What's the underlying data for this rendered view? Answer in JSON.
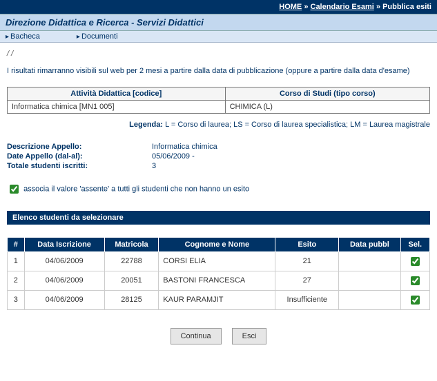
{
  "topnav": {
    "home": "HOME",
    "sep": "»",
    "calendar": "Calendario Esami",
    "publish": "Pubblica esiti"
  },
  "titlebar": "Direzione Didattica e Ricerca - Servizi Didattici",
  "menu": {
    "bacheca": "Bacheca",
    "documenti": "Documenti"
  },
  "slashes": "/ /",
  "intro": "I risultati rimarranno visibili sul web per 2 mesi a partire dalla data di pubblicazione (oppure a partire dalla data d'esame)",
  "course_table": {
    "h_activity": "Attività Didattica [codice]",
    "h_course": "Corso di Studi (tipo corso)",
    "activity": "Informatica chimica [MN1 005]",
    "course": "CHIMICA (L)"
  },
  "legend": {
    "label": "Legenda:",
    "text": " L = Corso di laurea; LS = Corso di laurea specialistica; LM = Laurea magistrale"
  },
  "details": {
    "desc_label": "Descrizione Appello:",
    "desc_value": "Informatica chimica",
    "dates_label": "Date Appello (dal-al):",
    "dates_value": "05/06/2009 -",
    "total_label": "Totale studenti iscritti:",
    "total_value": "3"
  },
  "absent_checkbox_label": "associa il valore 'assente' a tutti gli studenti che non hanno un esito",
  "section_title": "Elenco studenti da selezionare",
  "students_table": {
    "headers": {
      "num": "#",
      "date": "Data Iscrizione",
      "mat": "Matricola",
      "name": "Cognome e Nome",
      "esito": "Esito",
      "pub": "Data pubbl",
      "sel": "Sel."
    },
    "rows": [
      {
        "num": "1",
        "date": "04/06/2009",
        "mat": "22788",
        "name": "CORSI ELIA",
        "esito": "21",
        "pub": "",
        "sel": true
      },
      {
        "num": "2",
        "date": "04/06/2009",
        "mat": "20051",
        "name": "BASTONI FRANCESCA",
        "esito": "27",
        "pub": "",
        "sel": true
      },
      {
        "num": "3",
        "date": "04/06/2009",
        "mat": "28125",
        "name": "KAUR PARAMJIT",
        "esito": "Insufficiente",
        "pub": "",
        "sel": true
      }
    ]
  },
  "buttons": {
    "continua": "Continua",
    "esci": "Esci"
  }
}
